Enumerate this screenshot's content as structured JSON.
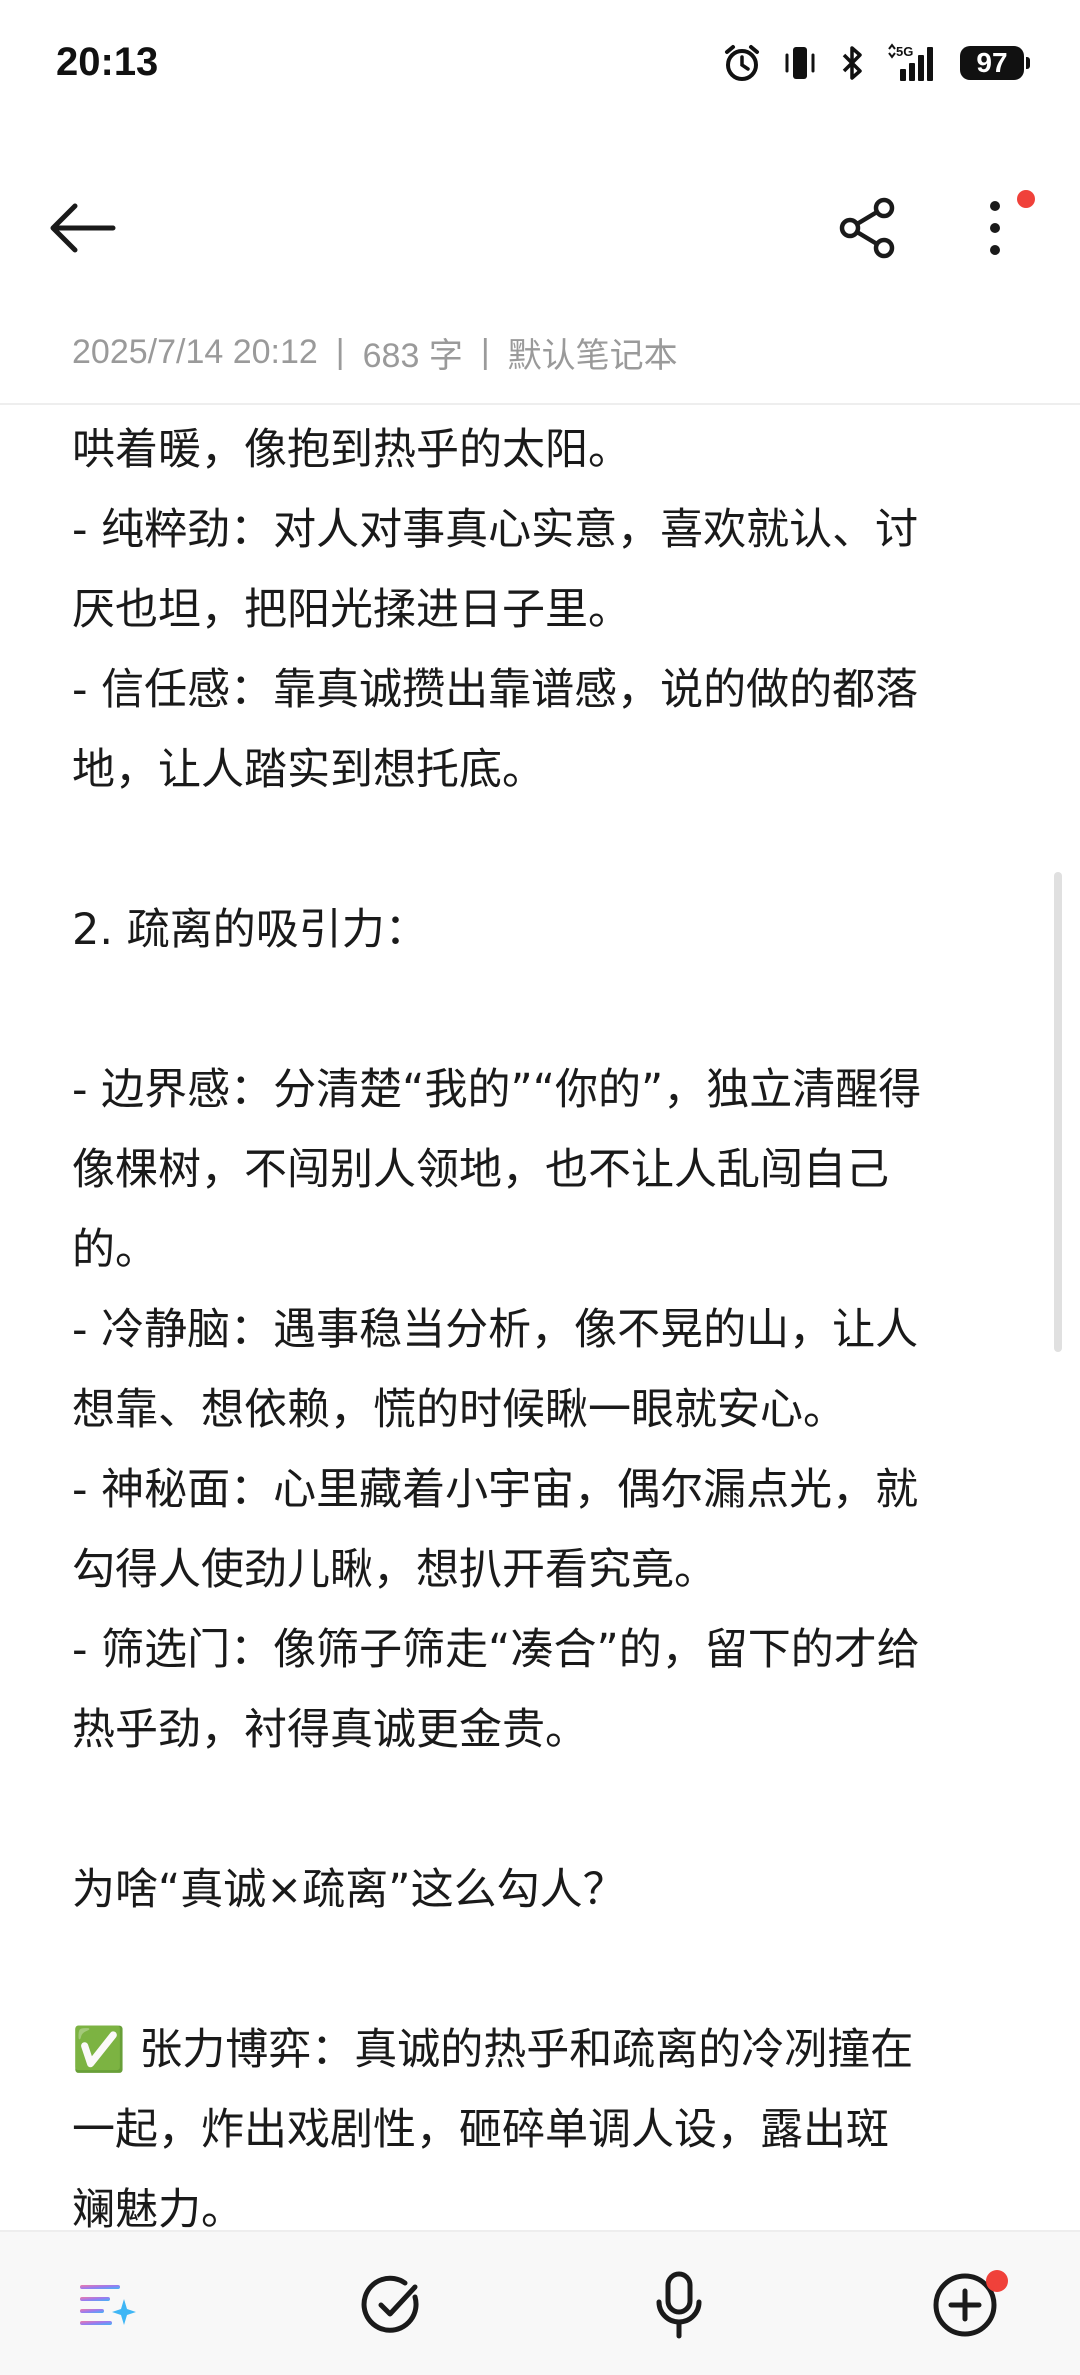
{
  "status_bar": {
    "time": "20:13",
    "icons": [
      "alarm-icon",
      "vibrate-icon",
      "bluetooth-icon",
      "5g-signal-icon"
    ],
    "battery": "97"
  },
  "toolbar": {
    "back_icon": "arrow-left-icon",
    "share_icon": "share-icon",
    "more_icon": "more-vertical-icon",
    "notification_dot_color": "#f0413a"
  },
  "meta": {
    "datetime": "2025/7/14 20:12",
    "separator": "|",
    "word_count": "683 字",
    "notebook": "默认笔记本"
  },
  "content": {
    "lines": [
      "哄着暖，像抱到热乎的太阳。",
      "- 纯粹劲：对人对事真心实意，喜欢就认、讨",
      "厌也坦，把阳光揉进日子里。",
      "- 信任感：靠真诚攒出靠谱感，说的做的都落",
      "地，让人踏实到想托底。",
      "",
      "2. 疏离的吸引力：",
      "",
      "- 边界感：分清楚“我的”“你的”，独立清醒得",
      "像棵树，不闯别人领地，也不让人乱闯自己",
      "的。",
      "- 冷静脑：遇事稳当分析，像不晃的山，让人",
      "想靠、想依赖，慌的时候瞅一眼就安心。",
      "- 神秘面：心里藏着小宇宙，偶尔漏点光，就",
      "勾得人使劲儿瞅，想扒开看究竟。",
      "- 筛选门：像筛子筛走“凑合”的，留下的才给",
      "热乎劲，衬得真诚更金贵。",
      "",
      "为啥“真诚×疏离”这么勾人？",
      "",
      "✅ 张力博弈：真诚的热乎和疏离的冷冽撞在",
      "一起，炸出戏剧性，砸碎单调人设，露出斑",
      "斓魅力。"
    ]
  },
  "bottom_bar": {
    "items": [
      {
        "name": "ai-text-icon"
      },
      {
        "name": "checklist-icon"
      },
      {
        "name": "microphone-icon"
      },
      {
        "name": "add-icon"
      }
    ]
  }
}
